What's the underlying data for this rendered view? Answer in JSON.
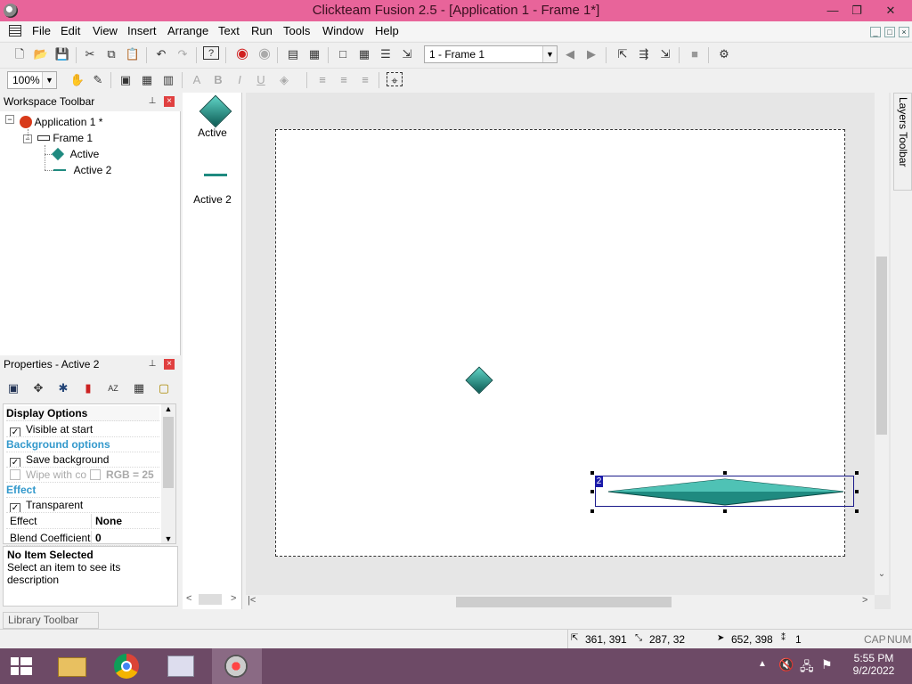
{
  "window": {
    "title": "Clickteam Fusion 2.5 - [Application 1 - Frame 1*]",
    "minimize": "—",
    "restore": "❐",
    "close": "✕"
  },
  "menu": [
    "File",
    "Edit",
    "View",
    "Insert",
    "Arrange",
    "Text",
    "Run",
    "Tools",
    "Window",
    "Help"
  ],
  "toolbar": {
    "frame_select": "1 - Frame 1",
    "zoom": "100%"
  },
  "workspace": {
    "title": "Workspace Toolbar",
    "tree": [
      {
        "label": "Application 1 *"
      },
      {
        "label": "Frame 1"
      },
      {
        "label": "Active"
      },
      {
        "label": "Active 2"
      }
    ]
  },
  "object_list": [
    {
      "label": "Active"
    },
    {
      "label": "Active 2"
    }
  ],
  "properties": {
    "title": "Properties - Active 2",
    "rows": {
      "display_options": "Display Options",
      "visible_at_start": "Visible at start",
      "background_options": "Background options",
      "save_background": "Save background",
      "wipe_with_color": "Wipe with co",
      "rgb": "RGB = 25",
      "effect_section": "Effect",
      "transparent": "Transparent",
      "effect_label": "Effect",
      "effect_value": "None",
      "blend_label": "Blend Coefficient",
      "blend_value": "0"
    },
    "description_title": "No Item Selected",
    "description_text": "Select an item to see its description"
  },
  "layers_toolbar": "Layers Toolbar",
  "library_toolbar": "Library Toolbar",
  "selection_badge": "2",
  "status": {
    "pos1": "361, 391",
    "size": "287, 32",
    "cursor": "652, 398",
    "count": "1",
    "cap": "CAP",
    "num": "NUM"
  },
  "clock": {
    "time": "5:55 PM",
    "date": "9/2/2022"
  },
  "colors": {
    "titlebar": "#e8649a",
    "taskbar": "#6d4a66",
    "diamond": "#1f8a80",
    "section": "#3399cc"
  }
}
